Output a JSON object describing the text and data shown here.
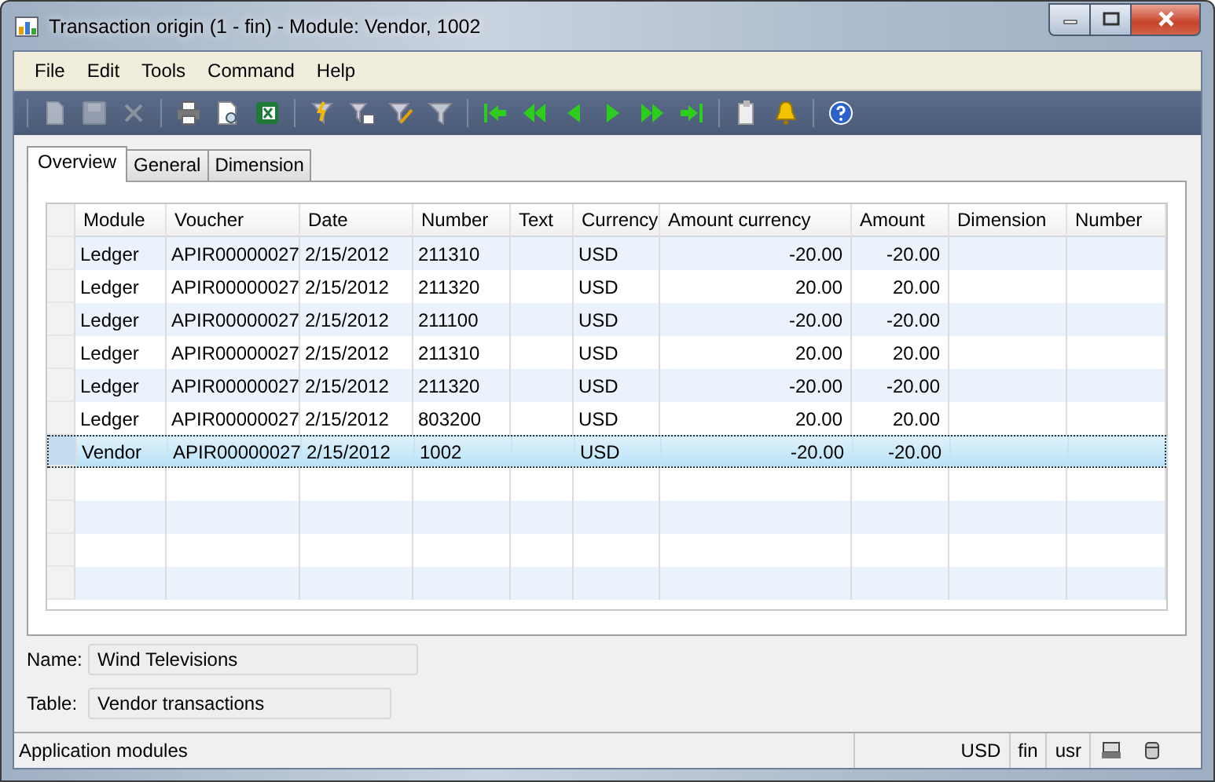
{
  "window": {
    "title": "Transaction origin (1 - fin) - Module: Vendor, 1002"
  },
  "menu": [
    "File",
    "Edit",
    "Tools",
    "Command",
    "Help"
  ],
  "toolbar": [
    [
      {
        "kind": "new",
        "disabled": true
      },
      {
        "kind": "save",
        "disabled": true
      },
      {
        "kind": "delete",
        "disabled": true
      }
    ],
    [
      {
        "kind": "print",
        "disabled": false
      },
      {
        "kind": "preview",
        "disabled": false
      },
      {
        "kind": "excel",
        "disabled": false
      }
    ],
    [
      {
        "kind": "filter-selection",
        "disabled": false
      },
      {
        "kind": "filter-form",
        "disabled": false
      },
      {
        "kind": "filter-advanced",
        "disabled": false
      },
      {
        "kind": "filter-remove",
        "disabled": false
      }
    ],
    [
      {
        "kind": "first",
        "disabled": false
      },
      {
        "kind": "prev-page",
        "disabled": false
      },
      {
        "kind": "prev",
        "disabled": false
      },
      {
        "kind": "next",
        "disabled": false
      },
      {
        "kind": "next-page",
        "disabled": false
      },
      {
        "kind": "last",
        "disabled": false
      }
    ],
    [
      {
        "kind": "document",
        "disabled": false
      },
      {
        "kind": "alert",
        "disabled": false
      }
    ],
    [
      {
        "kind": "help",
        "disabled": false
      }
    ]
  ],
  "tabs": [
    {
      "label": "Overview",
      "selected": true
    },
    {
      "label": "General",
      "selected": false
    },
    {
      "label": "Dimension",
      "selected": false
    }
  ],
  "table": {
    "columns": [
      "Module",
      "Voucher",
      "Date",
      "Number",
      "Text",
      "Currency",
      "Amount currency",
      "Amount",
      "Dimension",
      "Number"
    ],
    "rows": [
      {
        "module": "Ledger",
        "voucher": "APIR00000027",
        "date": "2/15/2012",
        "number": "211310",
        "currency": "USD",
        "amount_currency": "-20.00",
        "amount": "-20.00",
        "selected": false
      },
      {
        "module": "Ledger",
        "voucher": "APIR00000027",
        "date": "2/15/2012",
        "number": "211320",
        "currency": "USD",
        "amount_currency": "20.00",
        "amount": "20.00",
        "selected": false
      },
      {
        "module": "Ledger",
        "voucher": "APIR00000027",
        "date": "2/15/2012",
        "number": "211100",
        "currency": "USD",
        "amount_currency": "-20.00",
        "amount": "-20.00",
        "selected": false
      },
      {
        "module": "Ledger",
        "voucher": "APIR00000027",
        "date": "2/15/2012",
        "number": "211310",
        "currency": "USD",
        "amount_currency": "20.00",
        "amount": "20.00",
        "selected": false
      },
      {
        "module": "Ledger",
        "voucher": "APIR00000027",
        "date": "2/15/2012",
        "number": "211320",
        "currency": "USD",
        "amount_currency": "-20.00",
        "amount": "-20.00",
        "selected": false
      },
      {
        "module": "Ledger",
        "voucher": "APIR00000027",
        "date": "2/15/2012",
        "number": "803200",
        "currency": "USD",
        "amount_currency": "20.00",
        "amount": "20.00",
        "selected": false
      },
      {
        "module": "Vendor",
        "voucher": "APIR00000027",
        "date": "2/15/2012",
        "number": "1002",
        "currency": "USD",
        "amount_currency": "-20.00",
        "amount": "-20.00",
        "selected": true
      }
    ]
  },
  "fields": [
    {
      "label": "Name:",
      "value": "Wind Televisions"
    },
    {
      "label": "Table:",
      "value": "Vendor transactions"
    }
  ],
  "status_bar": {
    "text": "Application modules",
    "items": [
      "USD",
      "fin",
      "usr"
    ]
  }
}
